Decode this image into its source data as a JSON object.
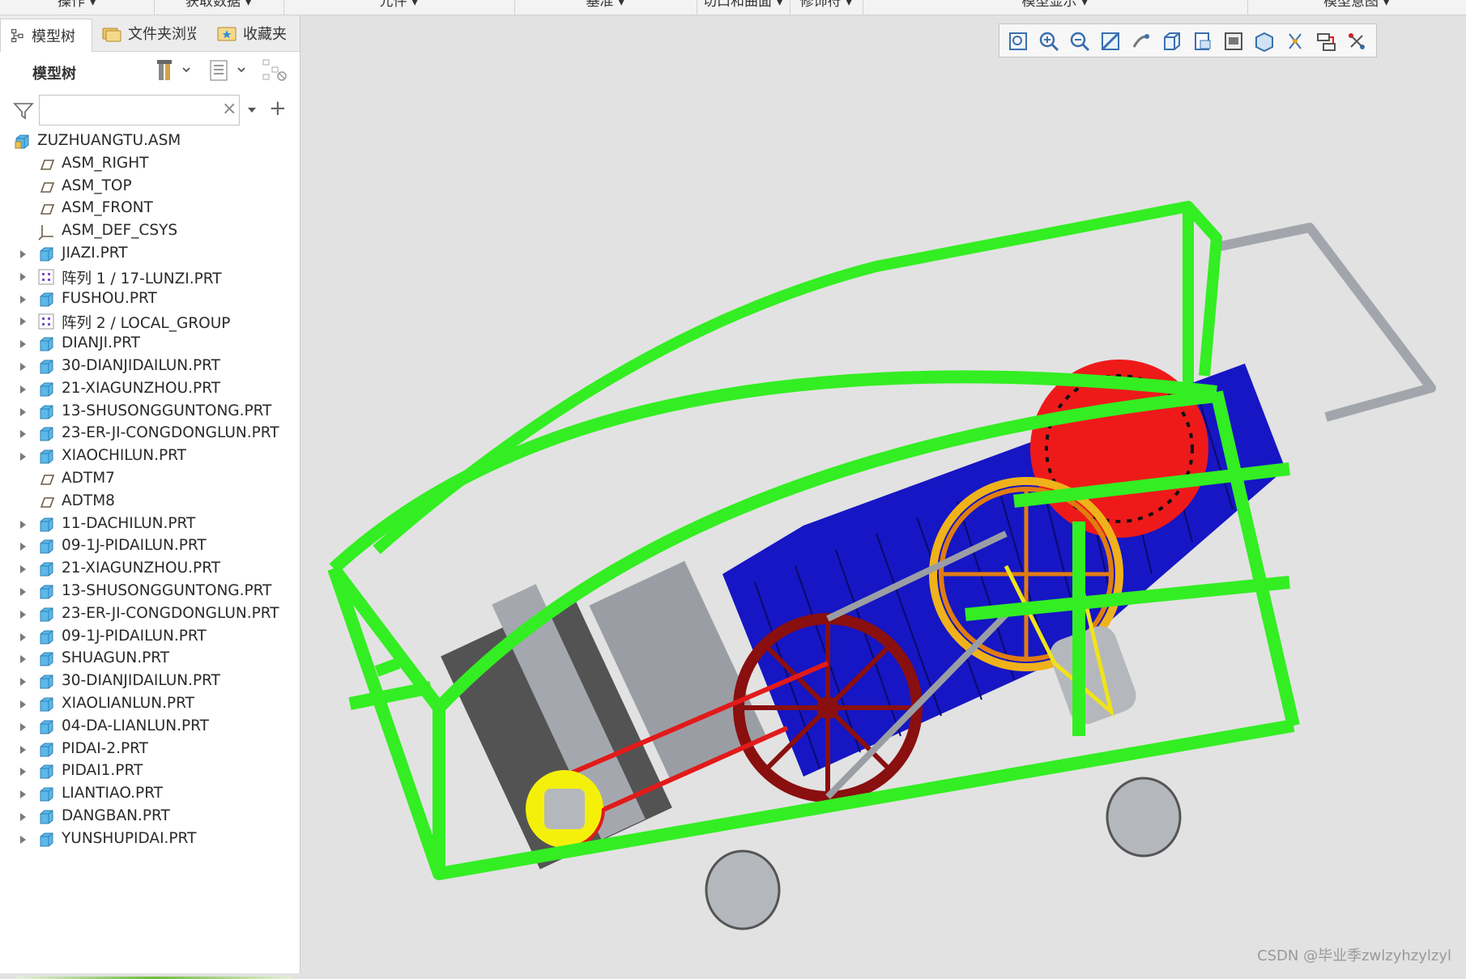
{
  "ribbon": {
    "groups": [
      "操作 ▾",
      "获取数据 ▾",
      "元件 ▾",
      "基准 ▾",
      "切口和曲面 ▾",
      "修饰符 ▾",
      "模型显示 ▾",
      "模型意图 ▾"
    ]
  },
  "panel": {
    "tabs": [
      {
        "label": "模型树",
        "icon": "model-tree-icon"
      },
      {
        "label": "文件夹浏览",
        "icon": "folder-browser-icon"
      },
      {
        "label": "收藏夹",
        "icon": "favorites-icon"
      }
    ],
    "tree_title": "模型树",
    "search": {
      "value": "",
      "clear": "×"
    },
    "add": "+"
  },
  "tree": {
    "root": "ZUZHUANGTU.ASM",
    "items": [
      {
        "label": "ASM_RIGHT",
        "icon": "datum-plane-icon",
        "expandable": false
      },
      {
        "label": "ASM_TOP",
        "icon": "datum-plane-icon",
        "expandable": false
      },
      {
        "label": "ASM_FRONT",
        "icon": "datum-plane-icon",
        "expandable": false
      },
      {
        "label": "ASM_DEF_CSYS",
        "icon": "coordinate-system-icon",
        "expandable": false
      },
      {
        "label": "JIAZI.PRT",
        "icon": "part-icon",
        "expandable": true
      },
      {
        "label": "阵列 1 / 17-LUNZI.PRT",
        "icon": "pattern-icon",
        "expandable": true
      },
      {
        "label": "FUSHOU.PRT",
        "icon": "part-icon",
        "expandable": true
      },
      {
        "label": "阵列 2 / LOCAL_GROUP",
        "icon": "pattern-icon",
        "expandable": true
      },
      {
        "label": "DIANJI.PRT",
        "icon": "part-icon",
        "expandable": true
      },
      {
        "label": "30-DIANJIDAILUN.PRT",
        "icon": "part-icon",
        "expandable": true
      },
      {
        "label": "21-XIAGUNZHOU.PRT",
        "icon": "part-icon",
        "expandable": true
      },
      {
        "label": "13-SHUSONGGUNTONG.PRT",
        "icon": "part-icon",
        "expandable": true
      },
      {
        "label": "23-ER-JI-CONGDONGLUN.PRT",
        "icon": "part-icon",
        "expandable": true
      },
      {
        "label": "XIAOCHILUN.PRT",
        "icon": "part-icon",
        "expandable": true
      },
      {
        "label": "ADTM7",
        "icon": "datum-plane-icon",
        "expandable": false
      },
      {
        "label": "ADTM8",
        "icon": "datum-plane-icon",
        "expandable": false
      },
      {
        "label": "11-DACHILUN.PRT",
        "icon": "part-icon",
        "expandable": true
      },
      {
        "label": "09-1J-PIDAILUN.PRT",
        "icon": "part-icon",
        "expandable": true
      },
      {
        "label": "21-XIAGUNZHOU.PRT",
        "icon": "part-icon",
        "expandable": true
      },
      {
        "label": "13-SHUSONGGUNTONG.PRT",
        "icon": "part-icon",
        "expandable": true
      },
      {
        "label": "23-ER-JI-CONGDONGLUN.PRT",
        "icon": "part-icon",
        "expandable": true
      },
      {
        "label": "09-1J-PIDAILUN.PRT",
        "icon": "part-icon",
        "expandable": true
      },
      {
        "label": "SHUAGUN.PRT",
        "icon": "part-icon",
        "expandable": true
      },
      {
        "label": "30-DIANJIDAILUN.PRT",
        "icon": "part-icon",
        "expandable": true
      },
      {
        "label": "XIAOLIANLUN.PRT",
        "icon": "part-icon",
        "expandable": true
      },
      {
        "label": "04-DA-LIANLUN.PRT",
        "icon": "part-icon",
        "expandable": true
      },
      {
        "label": "PIDAI-2.PRT",
        "icon": "part-icon",
        "expandable": true
      },
      {
        "label": "PIDAI1.PRT",
        "icon": "part-icon",
        "expandable": true
      },
      {
        "label": "LIANTIAO.PRT",
        "icon": "part-icon",
        "expandable": true
      },
      {
        "label": "DANGBAN.PRT",
        "icon": "part-icon",
        "expandable": true
      },
      {
        "label": "YUNSHUPIDAI.PRT",
        "icon": "part-icon",
        "expandable": true
      }
    ]
  },
  "graphics_toolbar": [
    "refit-icon",
    "zoom-in-icon",
    "zoom-out-icon",
    "repaint-icon",
    "spin-center-icon",
    "display-style-icon",
    "saved-views-icon",
    "view-manager-icon",
    "perspective-icon",
    "datum-display-icon",
    "annotation-display-icon",
    "section-icon"
  ],
  "colors": {
    "frame": "#33ee22",
    "conveyor": "#1a1ac8",
    "gear": "#ee1a1a",
    "pulley_big": "#f0b21a",
    "pulley_dark": "#8a0f0f",
    "steel": "#a4a8ae"
  },
  "watermark": "CSDN @毕业季zwlzyhzylzyl"
}
